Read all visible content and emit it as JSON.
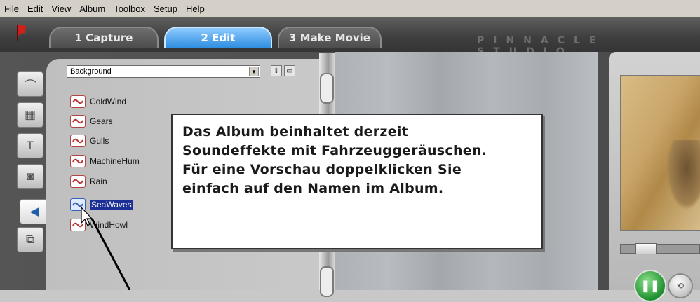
{
  "menu": {
    "items": [
      {
        "acc": "F",
        "rest": "ile"
      },
      {
        "acc": "E",
        "rest": "dit"
      },
      {
        "acc": "V",
        "rest": "iew"
      },
      {
        "acc": "A",
        "rest": "lbum"
      },
      {
        "acc": "T",
        "rest": "oolbox"
      },
      {
        "acc": "S",
        "rest": "etup"
      },
      {
        "acc": "H",
        "rest": "elp"
      }
    ]
  },
  "tabs": {
    "capture": "1 Capture",
    "edit": "2 Edit",
    "make_movie": "3 Make Movie"
  },
  "brand": "PINNACLE STUDIO",
  "album": {
    "category": "Background",
    "items": [
      "ColdWind",
      "Gears",
      "Gulls",
      "MachineHum",
      "Rain",
      "SeaWaves",
      "WindHowl"
    ],
    "selected": "SeaWaves"
  },
  "callout": {
    "lines": [
      "Das Album beinhaltet derzeit",
      "Soundeffekte mit Fahrzeuggeräuschen.",
      "Für eine Vorschau doppelklicken Sie",
      "einfach auf den Namen im Album."
    ]
  },
  "icons": {
    "side_tools": [
      "video-scenes-icon",
      "transitions-icon",
      "titles-icon",
      "still-images-icon",
      "sound-effects-icon",
      "menus-icon"
    ],
    "album_buttons": [
      "folder-up-icon",
      "folder-icon"
    ],
    "player": [
      "pause-icon",
      "loop-icon"
    ]
  },
  "colors": {
    "active_tab": "#2f8ee0",
    "selection": "#1c2f96",
    "play_button": "#1e8f2e"
  }
}
